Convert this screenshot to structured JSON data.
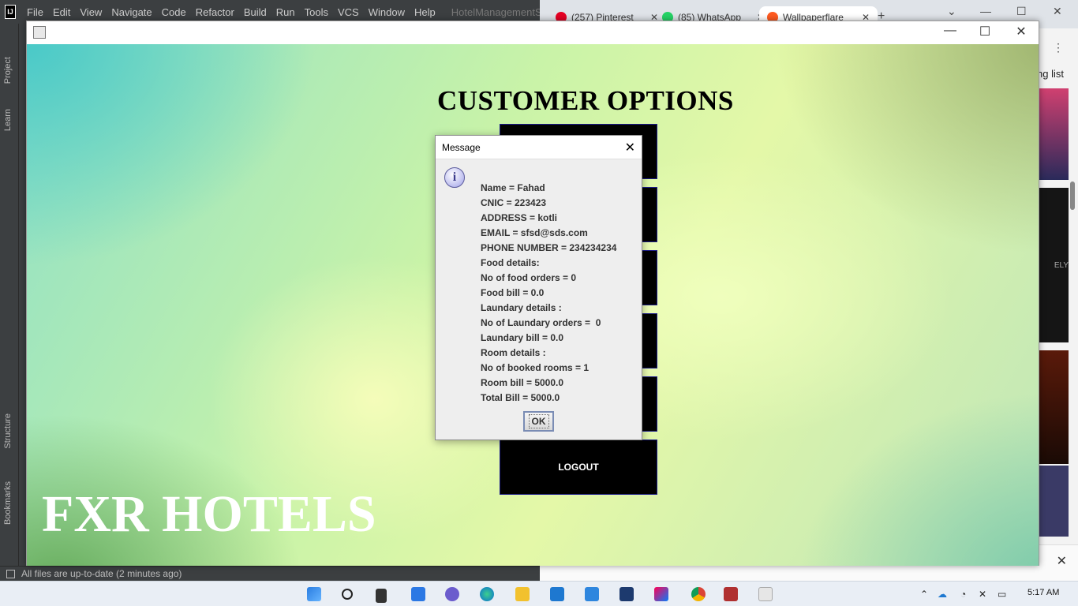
{
  "ide": {
    "logo": "IJ",
    "menu": [
      "File",
      "Edit",
      "View",
      "Navigate",
      "Code",
      "Refactor",
      "Build",
      "Run",
      "Tools",
      "VCS",
      "Window",
      "Help"
    ],
    "project_name": "HotelManagementSystem",
    "left_strip": {
      "project": "Project",
      "learn": "Learn",
      "structure": "Structure",
      "bookmarks": "Bookmarks"
    },
    "status": "All files are up-to-date (2 minutes ago)"
  },
  "browser": {
    "tabs": [
      {
        "label": "(257) Pinterest",
        "color": "#e60023"
      },
      {
        "label": "(85) WhatsApp",
        "color": "#25d366"
      },
      {
        "label": "Wallpaperflare",
        "color": "#ff5a1f"
      }
    ],
    "new_tab": "+",
    "side_text": "ng list",
    "thumb_text": "ELY"
  },
  "app": {
    "screen_title": "CUSTOMER OPTIONS",
    "hotel_name": "FXR HOTELS",
    "options": [
      "",
      "",
      "",
      "",
      "",
      "LOGOUT"
    ]
  },
  "dialog": {
    "title": "Message",
    "lines": [
      "Name = Fahad",
      "CNIC = 223423",
      "ADDRESS = kotli",
      "EMAIL = sfsd@sds.com",
      "PHONE NUMBER = 234234234",
      "Food details:",
      "No of food orders = 0",
      "Food bill = 0.0",
      "Laundary details :",
      "No of Laundary orders =  0",
      "Laundary bill = 0.0",
      "Room details :",
      "No of booked rooms = 1",
      "Room bill = 5000.0",
      "Total Bill = 5000.0"
    ],
    "ok_label": "OK",
    "icon": "info-icon"
  },
  "taskbar": {
    "time": "5:17 AM",
    "apps": [
      "start-icon",
      "search-icon",
      "file-icon",
      "widgets-icon",
      "chat-icon",
      "edge-icon",
      "explorer-icon",
      "mail-icon",
      "store-icon",
      "app-icon",
      "intellij-icon",
      "chrome-icon",
      "app2-icon",
      "java-icon"
    ]
  }
}
